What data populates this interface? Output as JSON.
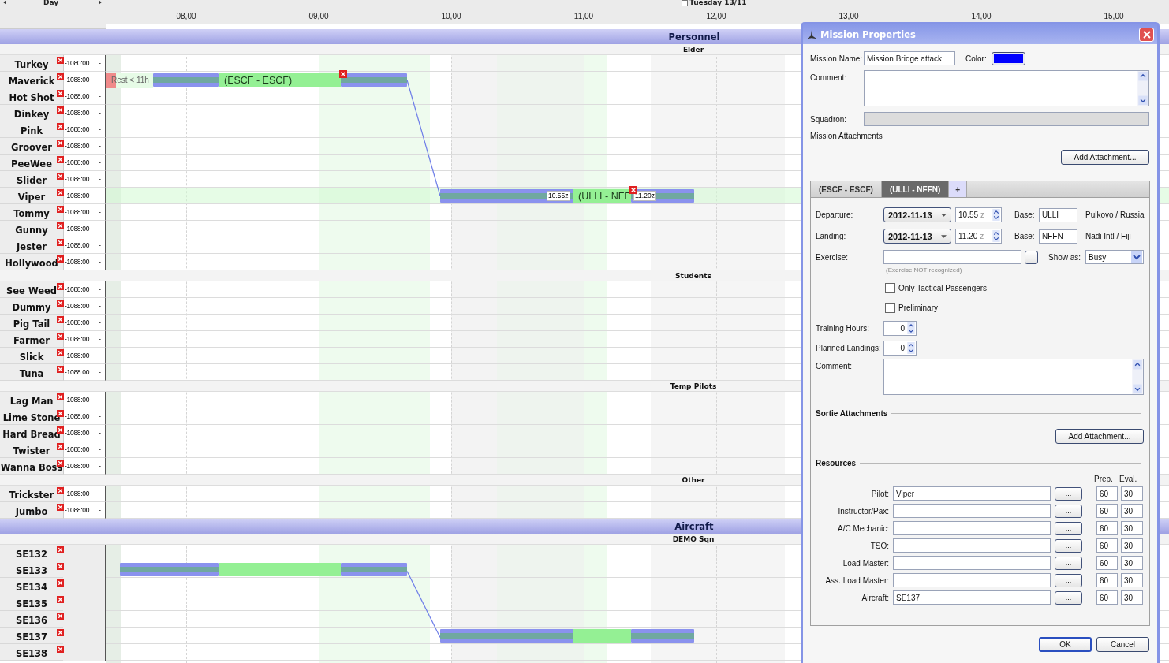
{
  "timeline": {
    "view": "Day",
    "date": "Tuesday 13/11",
    "date_checked": false,
    "hours": [
      "08,00",
      "09,00",
      "10,00",
      "11,00",
      "12,00",
      "13,00",
      "14,00",
      "15,00"
    ]
  },
  "groups": [
    {
      "title": "Personnel",
      "sections": [
        {
          "title": "Elder",
          "rows": [
            {
              "name": "Turkey",
              "hours": "-1080:00",
              "column_3": "-",
              "selected": false
            },
            {
              "name": "Maverick",
              "hours": "-1088:00",
              "column_3": "-",
              "selected": false,
              "bar": {
                "kind": "first",
                "label": "(ESCF - ESCF)",
                "warning": "Rest < 11h",
                "deletable": true
              }
            },
            {
              "name": "Hot Shot",
              "hours": "-1088:00",
              "column_3": "-",
              "selected": false
            },
            {
              "name": "Dinkey",
              "hours": "-1088:00",
              "column_3": "-",
              "selected": false
            },
            {
              "name": "Pink",
              "hours": "-1088:00",
              "column_3": "-",
              "selected": false
            },
            {
              "name": "Groover",
              "hours": "-1088:00",
              "column_3": "-",
              "selected": false
            },
            {
              "name": "PeeWee",
              "hours": "-1088:00",
              "column_3": "-",
              "selected": false
            },
            {
              "name": "Slider",
              "hours": "-1088:00",
              "column_3": "-",
              "selected": false
            },
            {
              "name": "Viper",
              "hours": "-1088:00",
              "column_3": "-",
              "selected": true,
              "bar": {
                "kind": "second",
                "label": "(ULLI - NFF",
                "start": "10.55z",
                "end": "11.20z",
                "deletable": true
              }
            },
            {
              "name": "Tommy",
              "hours": "-1088:00",
              "column_3": "-",
              "selected": false
            },
            {
              "name": "Gunny",
              "hours": "-1088:00",
              "column_3": "-",
              "selected": false
            },
            {
              "name": "Jester",
              "hours": "-1088:00",
              "column_3": "-",
              "selected": false
            },
            {
              "name": "Hollywood",
              "hours": "-1088:00",
              "column_3": "-",
              "selected": false
            }
          ]
        },
        {
          "title": "Students",
          "rows": [
            {
              "name": "See Weed",
              "hours": "-1088:00",
              "column_3": "-",
              "selected": false
            },
            {
              "name": "Dummy",
              "hours": "-1088:00",
              "column_3": "-",
              "selected": false
            },
            {
              "name": "Pig Tail",
              "hours": "-1088:00",
              "column_3": "-",
              "selected": false
            },
            {
              "name": "Farmer",
              "hours": "-1088:00",
              "column_3": "-",
              "selected": false
            },
            {
              "name": "Slick",
              "hours": "-1088:00",
              "column_3": "-",
              "selected": false
            },
            {
              "name": "Tuna",
              "hours": "-1088:00",
              "column_3": "-",
              "selected": false
            }
          ]
        },
        {
          "title": "Temp Pilots",
          "rows": [
            {
              "name": "Lag Man",
              "hours": "-1088:00",
              "column_3": "-",
              "selected": false
            },
            {
              "name": "Lime Stone",
              "hours": "-1088:00",
              "column_3": "-",
              "selected": false
            },
            {
              "name": "Hard Bread",
              "hours": "-1088:00",
              "column_3": "-",
              "selected": false
            },
            {
              "name": "Twister",
              "hours": "-1088:00",
              "column_3": "-",
              "selected": false
            },
            {
              "name": "Wanna Boss",
              "hours": "-1088:00",
              "column_3": "-",
              "selected": false
            }
          ]
        },
        {
          "title": "Other",
          "rows": [
            {
              "name": "Trickster",
              "hours": "-1088:00",
              "column_3": "-",
              "selected": false
            },
            {
              "name": "Jumbo",
              "hours": "-1088:00",
              "column_3": "-",
              "selected": false
            }
          ]
        }
      ]
    },
    {
      "title": "Aircraft",
      "sections": [
        {
          "title": "DEMO Sqn",
          "rows": [
            {
              "name": "SE132",
              "selected": false
            },
            {
              "name": "SE133",
              "selected": false,
              "bar": {
                "kind": "first",
                "deletable": false
              }
            },
            {
              "name": "SE134",
              "selected": false
            },
            {
              "name": "SE135",
              "selected": false
            },
            {
              "name": "SE136",
              "selected": false
            },
            {
              "name": "SE137",
              "selected": false,
              "bar": {
                "kind": "second",
                "deletable": false
              }
            },
            {
              "name": "SE138",
              "selected": false
            }
          ]
        }
      ]
    }
  ],
  "dialog": {
    "title": "Mission Properties",
    "mission_name": {
      "label": "Mission Name:",
      "value": "Mission Bridge attack"
    },
    "color": {
      "label": "Color:"
    },
    "comment": {
      "label": "Comment:"
    },
    "squadron": {
      "label": "Squadron:",
      "disabled": true
    },
    "attachments": {
      "title": "Mission Attachments",
      "button": "Add Attachment..."
    },
    "tabs": [
      {
        "label": "(ESCF - ESCF)",
        "kind": "sortie",
        "selected": false
      },
      {
        "label": "(ULLI - NFFN)",
        "kind": "sortie",
        "selected": true
      },
      {
        "label": "+",
        "kind": "add",
        "selected": false
      }
    ],
    "legs": [
      {
        "label": "Departure:",
        "date": "2012-11-13",
        "time": "10.55",
        "zone": "z",
        "base_label": "Base:",
        "base": "ULLI",
        "place": "Pulkovo / Russia"
      },
      {
        "label": "Landing:",
        "date": "2012-11-13",
        "time": "11.20",
        "zone": "z",
        "base_label": "Base:",
        "base": "NFFN",
        "place": "Nadi Intl / Fiji"
      }
    ],
    "exercise": {
      "label": "Exercise:",
      "button": "...",
      "hint": "(Exercise NOT recognized)"
    },
    "show_as": {
      "label": "Show as:",
      "value": "Busy"
    },
    "checkboxes": [
      {
        "label": "Only Tactical Passengers",
        "checked": false
      },
      {
        "label": "Preliminary",
        "checked": false
      }
    ],
    "spinners": [
      {
        "label": "Training Hours:",
        "value": "0"
      },
      {
        "label": "Planned Landings:",
        "value": "0"
      }
    ],
    "sortie_comment": {
      "label": "Comment:"
    },
    "sortie_attachments": {
      "title": "Sortie Attachments",
      "button": "Add Attachment..."
    },
    "resources": {
      "title": "Resources",
      "columns": [
        "Prep.",
        "Eval."
      ],
      "rows": [
        {
          "label": "Pilot:",
          "value": "Viper",
          "button": "...",
          "prep": "60",
          "eval": "30"
        },
        {
          "label": "Instructor/Pax:",
          "button": "...",
          "prep": "60",
          "eval": "30"
        },
        {
          "label": "A/C Mechanic:",
          "button": "...",
          "prep": "60",
          "eval": "30"
        },
        {
          "label": "TSO:",
          "button": "...",
          "prep": "60",
          "eval": "30"
        },
        {
          "label": "Load Master:",
          "button": "...",
          "prep": "60",
          "eval": "30"
        },
        {
          "label": "Ass. Load Master:",
          "button": "...",
          "prep": "60",
          "eval": "30"
        },
        {
          "label": "Aircraft:",
          "value": "SE137",
          "button": "...",
          "prep": "60",
          "eval": "30"
        }
      ]
    },
    "buttons": [
      {
        "label": "OK",
        "kind": "default"
      },
      {
        "label": "Cancel",
        "kind": "normal"
      }
    ]
  }
}
